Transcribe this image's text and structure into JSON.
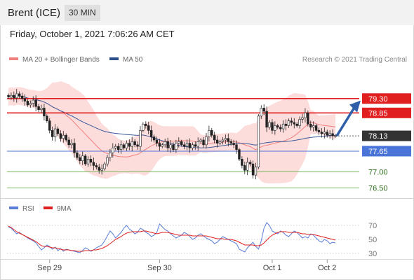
{
  "header": {
    "title": "Brent (ICE)",
    "timeframe": "30 MIN"
  },
  "timestamp": "Friday, October 1, 2021 7:06:26 AM CET",
  "copyright": "Research © 2021 Trading Central",
  "colors": {
    "bollinger_fill": "#fdd6d6",
    "ma20": "#f08080",
    "ma50": "#3a5a9a",
    "resistance": "#e02020",
    "support_blue": "#4a74d8",
    "support_green": "#6ab04c",
    "candle_up": "#ffffff",
    "candle_down": "#222222",
    "arrow": "#2f5fa8",
    "last_price": "#333333",
    "rsi": "#5a7ed8",
    "rsi_ma": "#e02020"
  },
  "chart_data": [
    {
      "type": "candlestick",
      "legend": [
        {
          "label": "MA 20 + Bollinger Bands",
          "color": "#f08080"
        },
        {
          "label": "MA 50",
          "color": "#2c4f8a"
        }
      ],
      "ylim": [
        76.2,
        79.8
      ],
      "x_labels": [
        "Sep 29",
        "Sep 30",
        "Oct 1",
        "Oct 2"
      ],
      "x_label_index": [
        15,
        55,
        96,
        116
      ],
      "n_bars": 120,
      "levels": [
        {
          "value": 79.3,
          "label": "79.30",
          "style": "resistance"
        },
        {
          "value": 78.85,
          "label": "78.85",
          "style": "resistance"
        },
        {
          "value": 78.13,
          "label": "78.13",
          "style": "last"
        },
        {
          "value": 77.65,
          "label": "77.65",
          "style": "pivot"
        },
        {
          "value": 77.0,
          "label": "77.00",
          "style": "support"
        },
        {
          "value": 76.5,
          "label": "76.50",
          "style": "support"
        }
      ],
      "forecast_arrow": {
        "from": 78.13,
        "to": 79.15
      },
      "closes": [
        79.35,
        79.4,
        79.32,
        79.45,
        79.38,
        79.3,
        79.22,
        79.1,
        79.15,
        79.25,
        79.05,
        78.95,
        79.0,
        78.75,
        78.6,
        78.3,
        78.1,
        78.35,
        78.2,
        78.05,
        78.15,
        78.0,
        77.85,
        77.9,
        77.6,
        77.45,
        77.35,
        77.5,
        77.25,
        77.4,
        77.3,
        77.2,
        77.15,
        77.05,
        77.1,
        77.25,
        77.45,
        77.6,
        77.75,
        77.8,
        77.7,
        77.85,
        77.75,
        77.9,
        77.8,
        77.95,
        77.85,
        77.8,
        78.3,
        78.5,
        78.45,
        78.3,
        78.1,
        78.0,
        77.9,
        77.8,
        77.85,
        77.95,
        77.75,
        77.85,
        77.7,
        77.9,
        77.95,
        77.85,
        77.8,
        77.9,
        77.75,
        77.85,
        77.8,
        77.95,
        78.0,
        77.85,
        78.1,
        78.3,
        78.15,
        78.0,
        77.9,
        77.95,
        78.0,
        78.05,
        77.95,
        77.9,
        77.85,
        77.7,
        77.4,
        77.2,
        77.05,
        77.3,
        77.25,
        76.9,
        77.15,
        78.75,
        79.0,
        78.9,
        78.4,
        78.55,
        78.3,
        78.45,
        78.4,
        78.35,
        78.5,
        78.45,
        78.6,
        78.55,
        78.5,
        78.45,
        78.65,
        78.7,
        78.85,
        78.5,
        78.4,
        78.45,
        78.3,
        78.25,
        78.2,
        78.25,
        78.15,
        78.2,
        78.13,
        78.13
      ]
    },
    {
      "type": "line",
      "legend": [
        {
          "label": "RSI",
          "color": "#5a7ed8"
        },
        {
          "label": "9MA",
          "color": "#e02020"
        }
      ],
      "ylim": [
        20,
        80
      ],
      "y_ticks": [
        70,
        50,
        30
      ],
      "series": [
        {
          "name": "RSI",
          "values": [
            68,
            66,
            62,
            58,
            60,
            57,
            55,
            52,
            50,
            48,
            45,
            40,
            35,
            38,
            42,
            40,
            36,
            39,
            34,
            37,
            33,
            36,
            35,
            34,
            33,
            32,
            31,
            34,
            38,
            36,
            33,
            35,
            38,
            40,
            42,
            48,
            55,
            62,
            58,
            52,
            56,
            60,
            66,
            70,
            65,
            62,
            58,
            60,
            66,
            64,
            60,
            58,
            54,
            56,
            60,
            72,
            68,
            64,
            62,
            58,
            55,
            52,
            54,
            56,
            60,
            58,
            54,
            50,
            52,
            56,
            58,
            55,
            52,
            50,
            48,
            44,
            46,
            50,
            54,
            52,
            50,
            48,
            46,
            44,
            36,
            34,
            32,
            38,
            42,
            46,
            40,
            36,
            48,
            66,
            74,
            70,
            62,
            60,
            58,
            62,
            60,
            56,
            54,
            58,
            62,
            60,
            56,
            52,
            54,
            52,
            58,
            56,
            52,
            48,
            46,
            50,
            48,
            44,
            46,
            45
          ]
        },
        {
          "name": "9MA",
          "values": [
            69,
            67,
            64,
            61,
            59,
            57,
            55,
            53,
            51,
            49,
            47,
            44,
            41,
            40,
            40,
            39,
            38,
            38,
            37,
            36,
            35,
            35,
            35,
            34,
            34,
            33,
            33,
            33,
            34,
            34,
            34,
            35,
            35,
            36,
            37,
            39,
            41,
            44,
            47,
            50,
            52,
            54,
            57,
            59,
            60,
            61,
            61,
            61,
            61,
            62,
            62,
            61,
            60,
            59,
            58,
            59,
            60,
            60,
            60,
            59,
            58,
            57,
            56,
            56,
            56,
            56,
            56,
            55,
            55,
            55,
            55,
            55,
            55,
            54,
            53,
            52,
            51,
            51,
            51,
            50,
            50,
            50,
            49,
            48,
            46,
            44,
            42,
            42,
            42,
            42,
            41,
            41,
            42,
            45,
            49,
            53,
            56,
            58,
            60,
            61,
            61,
            61,
            60,
            60,
            60,
            60,
            59,
            58,
            58,
            57,
            57,
            57,
            56,
            55,
            54,
            53,
            52,
            51,
            50,
            49
          ]
        }
      ]
    }
  ]
}
